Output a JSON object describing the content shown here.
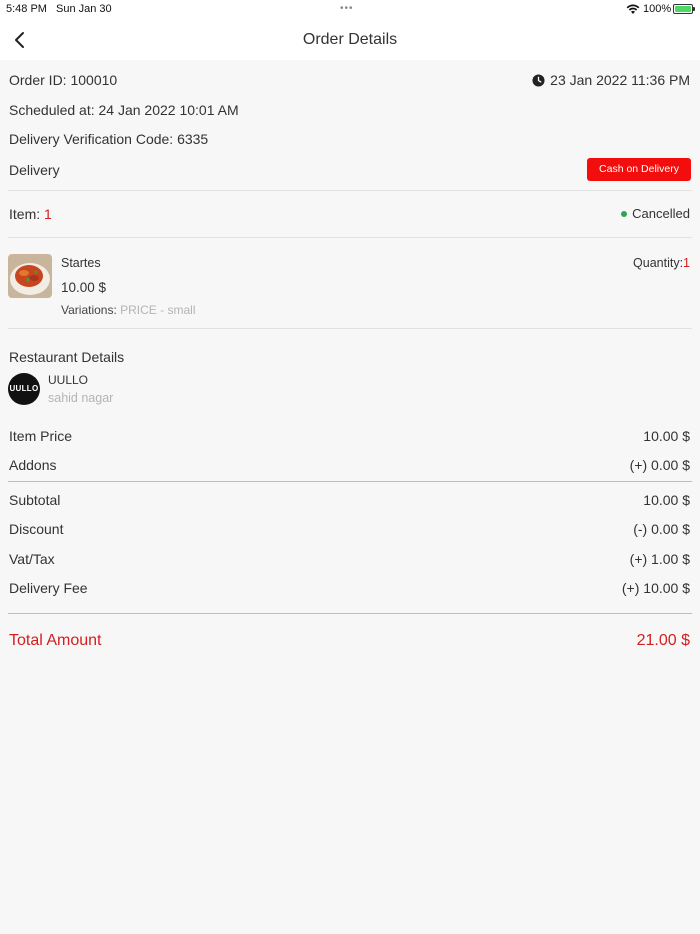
{
  "status_bar": {
    "time": "5:48 PM",
    "date": "Sun Jan 30",
    "dots": "•••",
    "battery": "100%"
  },
  "nav": {
    "title": "Order Details",
    "back_icon": "chevron-left-icon"
  },
  "order": {
    "order_id": "Order ID: 100010",
    "datetime": "23 Jan 2022  11:36 PM",
    "scheduled": "Scheduled at: 24 Jan 2022  10:01 AM",
    "verification": "Delivery Verification Code: 6335",
    "type": "Delivery",
    "payment": "Cash on Delivery",
    "item_label": "Item: ",
    "item_count": "1",
    "status": "Cancelled"
  },
  "item": {
    "name": "Startes",
    "price": "10.00 $",
    "variations_label": "Variations: ",
    "variations_value": "PRICE - small",
    "quantity_label": "Quantity:",
    "quantity_value": "1"
  },
  "restaurant": {
    "section_title": "Restaurant Details",
    "name": "UULLO",
    "address": "sahid nagar",
    "logo_text": "UULLO"
  },
  "summary": {
    "item_price_label": "Item Price",
    "item_price": "10.00 $",
    "addons_label": "Addons",
    "addons": "(+) 0.00 $",
    "subtotal_label": "Subtotal",
    "subtotal": "10.00 $",
    "discount_label": "Discount",
    "discount": "(-) 0.00 $",
    "vat_label": "Vat/Tax",
    "vat": "(+) 1.00 $",
    "delivery_fee_label": "Delivery Fee",
    "delivery_fee": "(+) 10.00 $",
    "total_label": "Total Amount",
    "total": "21.00 $"
  },
  "colors": {
    "accent": "#f40d0d",
    "total_text": "#d31f1f",
    "status_dot": "#2ea44f"
  }
}
